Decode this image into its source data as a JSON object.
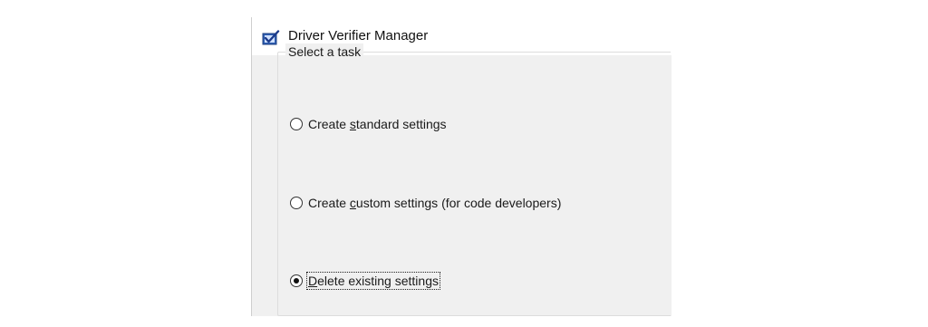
{
  "window": {
    "title": "Driver Verifier Manager",
    "icon": "driver-verifier-checkbox-icon"
  },
  "task_group": {
    "legend": "Select a task",
    "options": [
      {
        "pre": "Create ",
        "accel": "s",
        "post": "tandard settings",
        "full": "Create standard settings",
        "selected": false
      },
      {
        "pre": "Create ",
        "accel": "c",
        "post": "ustom settings (for code developers)",
        "full": "Create custom settings (for code developers)",
        "selected": false
      },
      {
        "pre": "",
        "accel": "D",
        "post": "elete existing settings",
        "full": "Delete existing settings",
        "selected": true
      }
    ]
  },
  "annotation": {
    "icon": "red-arrow-icon",
    "color": "#c8322a"
  },
  "colors": {
    "window_bg": "#f0f0f0",
    "titlebar_bg": "#ffffff",
    "text": "#1a1a1a",
    "arrow": "#c8322a"
  }
}
